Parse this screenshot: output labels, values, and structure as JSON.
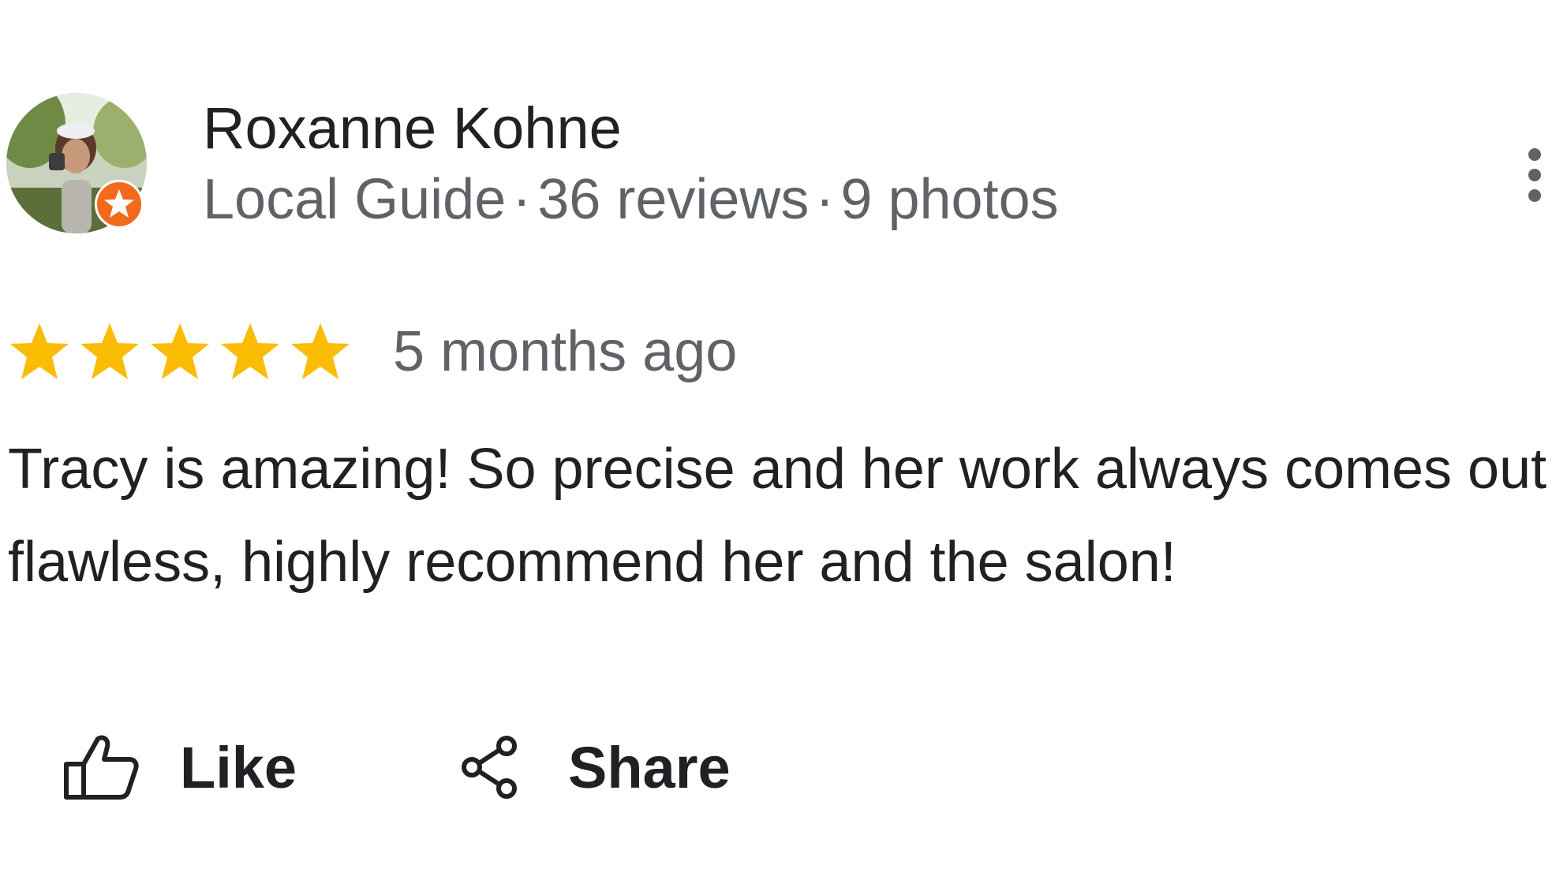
{
  "reviewer": {
    "name": "Roxanne Kohne",
    "badge": "Local Guide",
    "reviews": "36 reviews",
    "photos": "9 photos",
    "separator": "·",
    "badge_icon": "star-icon",
    "badge_color": "#f26b1d"
  },
  "menu": {
    "icon": "more-vert-icon"
  },
  "review": {
    "rating": 5,
    "max_rating": 5,
    "star_color": "#fbbc04",
    "time": "5 months ago",
    "text": "Tracy is amazing! So precise and her work always comes out flawless, highly recommend her and the salon!"
  },
  "actions": {
    "like_label": "Like",
    "like_icon": "thumbs-up-icon",
    "share_label": "Share",
    "share_icon": "share-icon"
  }
}
